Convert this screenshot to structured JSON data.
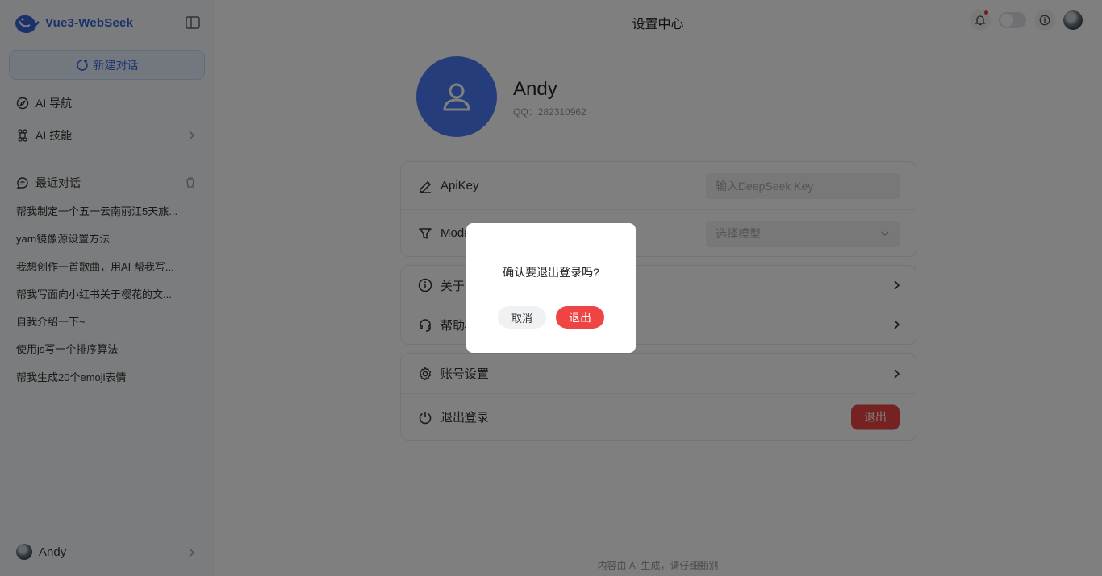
{
  "brand": {
    "name": "Vue3-WebSeek"
  },
  "sidebar": {
    "new_chat": "新建对话",
    "nav": [
      {
        "label": "AI 导航",
        "icon": "compass-icon"
      },
      {
        "label": "AI 技能",
        "icon": "command-icon"
      }
    ],
    "recent_title": "最近对话",
    "recent": [
      "帮我制定一个五一云南丽江5天旅...",
      "yarn镜像源设置方法",
      "我想创作一首歌曲，用AI 帮我写...",
      "帮我写面向小红书关于樱花的文...",
      "自我介绍一下~",
      "使用js写一个排序算法",
      "帮我生成20个emoji表情"
    ],
    "user": "Andy"
  },
  "header": {
    "title": "设置中心"
  },
  "profile": {
    "name": "Andy",
    "qq": "QQ：282310962"
  },
  "settings": {
    "apikey_label": "ApiKey",
    "apikey_placeholder": "输入DeepSeek Key",
    "model_label": "Model",
    "model_placeholder": "选择模型",
    "about_label": "关于",
    "help_label": "帮助与反馈",
    "account_label": "账号设置",
    "logout_label": "退出登录",
    "logout_button": "退出"
  },
  "footer": "内容由 AI 生成，请仔细甄别",
  "dialog": {
    "message": "确认要退出登录吗?",
    "cancel": "取消",
    "confirm": "退出"
  },
  "colors": {
    "accent": "#4a7cf6",
    "danger": "#ef4444",
    "brand": "#3563d8"
  }
}
